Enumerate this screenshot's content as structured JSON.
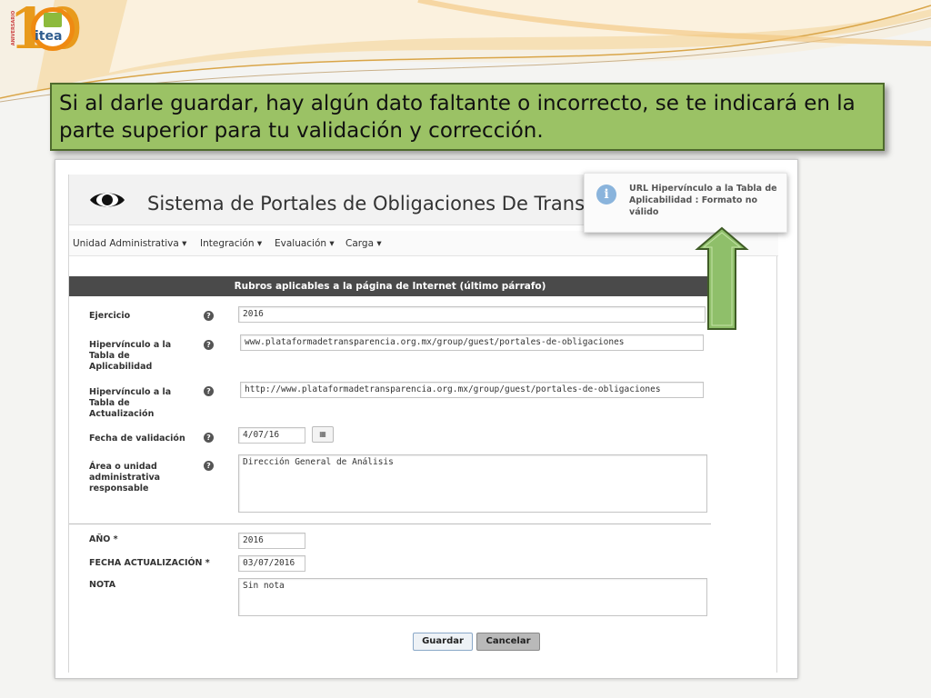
{
  "logo": {
    "digit": "10",
    "brand": "itea",
    "vertical_text": "ANIVERSARIO"
  },
  "callout": {
    "text": "Si al darle guardar, hay algún dato faltante o incorrecto, se te indicará en la parte superior para tu validación y corrección."
  },
  "app": {
    "title": "Sistema de Portales de Obligaciones De Transparencia"
  },
  "menu": {
    "items": [
      {
        "label": "Unidad Administrativa ▾"
      },
      {
        "label": "Integración ▾"
      },
      {
        "label": "Evaluación ▾"
      },
      {
        "label": "Carga ▾"
      }
    ]
  },
  "form": {
    "section_title": "Rubros aplicables a la página de Internet (último párrafo)",
    "help_glyph": "?",
    "calendar_glyph": "▦",
    "fields": {
      "ejercicio": {
        "label": "Ejercicio",
        "value": "2016"
      },
      "hipervinculo_aplicabilidad": {
        "label": "Hipervínculo a la Tabla de Aplicabilidad",
        "value": "www.plataformadetransparencia.org.mx/group/guest/portales-de-obligaciones"
      },
      "hipervinculo_actualizacion": {
        "label": "Hipervínculo a la Tabla de Actualización",
        "value": "http://www.plataformadetransparencia.org.mx/group/guest/portales-de-obligaciones"
      },
      "fecha_validacion": {
        "label": "Fecha de validación",
        "value": "4/07/16"
      },
      "area": {
        "label": "Área o unidad administrativa responsable",
        "value": "Dirección General de Análisis"
      },
      "anio": {
        "label": "AÑO *",
        "value": "2016"
      },
      "fecha_actualizacion": {
        "label": "FECHA ACTUALIZACIÓN *",
        "value": "03/07/2016"
      },
      "nota": {
        "label": "NOTA",
        "value": "Sin nota"
      }
    },
    "buttons": {
      "save": "Guardar",
      "cancel": "Cancelar"
    }
  },
  "toast": {
    "icon": "info-icon",
    "glyph": "i",
    "message": "URL Hipervínculo a la Tabla de Aplicabilidad : Formato no válido"
  },
  "colors": {
    "callout_bg": "#9bc265",
    "arrow": "#8fbf6a",
    "section_bar": "#4a4a4a"
  }
}
